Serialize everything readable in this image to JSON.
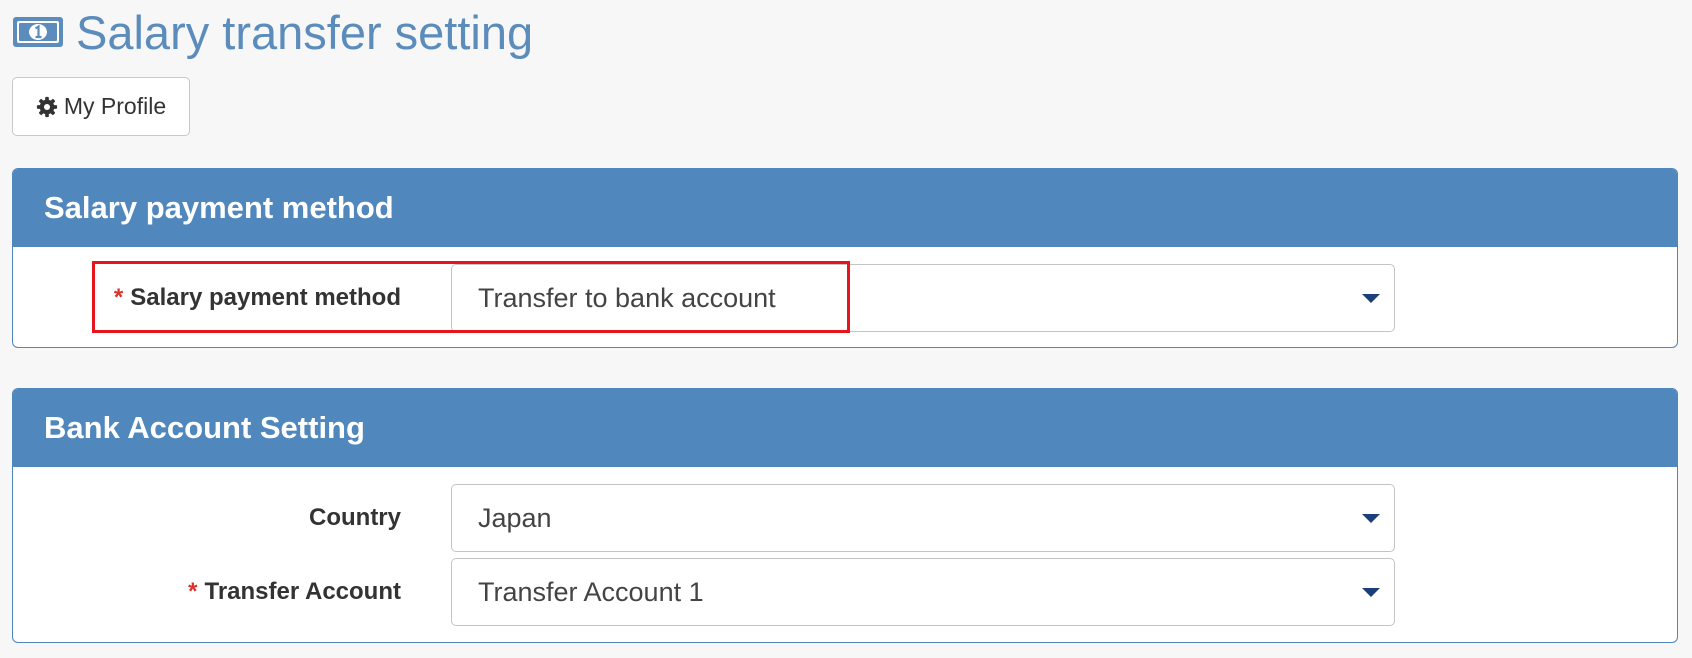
{
  "page": {
    "title": "Salary transfer setting",
    "title_icon": "money-bill-icon"
  },
  "profile_button": {
    "label": "My Profile",
    "icon": "gear-icon"
  },
  "salary_panel": {
    "header": "Salary payment method",
    "field": {
      "label": "Salary payment method",
      "required": "*",
      "value": "Transfer to bank account"
    }
  },
  "bank_panel": {
    "header": "Bank Account Setting",
    "fields": [
      {
        "label": "Country",
        "required": "",
        "value": "Japan"
      },
      {
        "label": "Transfer Account",
        "required": "*",
        "value": "Transfer Account 1"
      }
    ]
  },
  "colors": {
    "accent": "#5087bc",
    "title": "#5b8cbc",
    "required": "#d9332f",
    "highlight": "#e8141c"
  }
}
